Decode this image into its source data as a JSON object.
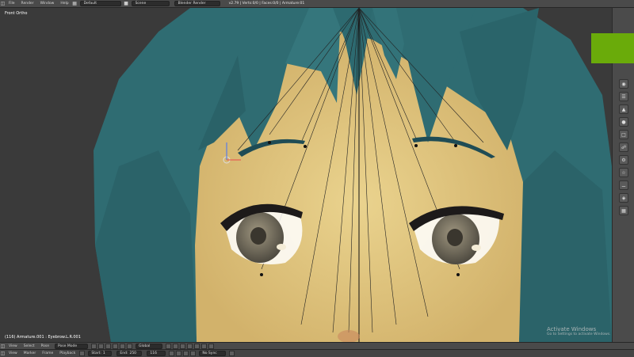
{
  "top_menu": {
    "items": [
      "File",
      "Render",
      "Window",
      "Help"
    ]
  },
  "top_fields": {
    "layout": "Default",
    "scene": "Scene",
    "engine": "Blender Render"
  },
  "top_stats": "v2.79 | Verts:0/0 | Faces:0/0 | Armature:01",
  "viewport": {
    "label": "Front Ortho",
    "status": "(116) Armature.001 : Eyebrow.L.R.001"
  },
  "watermark": {
    "title": "Activate Windows",
    "subtitle": "Go to Settings to activate Windows."
  },
  "bottom_bar1": {
    "menu": [
      "View",
      "Select",
      "Pose"
    ],
    "mode": "Pose Mode",
    "pivot": "Global"
  },
  "bottom_bar2": {
    "menu": [
      "View",
      "Marker",
      "Frame",
      "Playback"
    ],
    "start_label": "Start:",
    "start_val": "1",
    "end_label": "End:",
    "end_val": "250",
    "frame": "116",
    "sync": "No Sync"
  },
  "colors": {
    "accent_green": "#6aab0a",
    "hair": "#2f6c72",
    "skin": "#e5cc86"
  }
}
